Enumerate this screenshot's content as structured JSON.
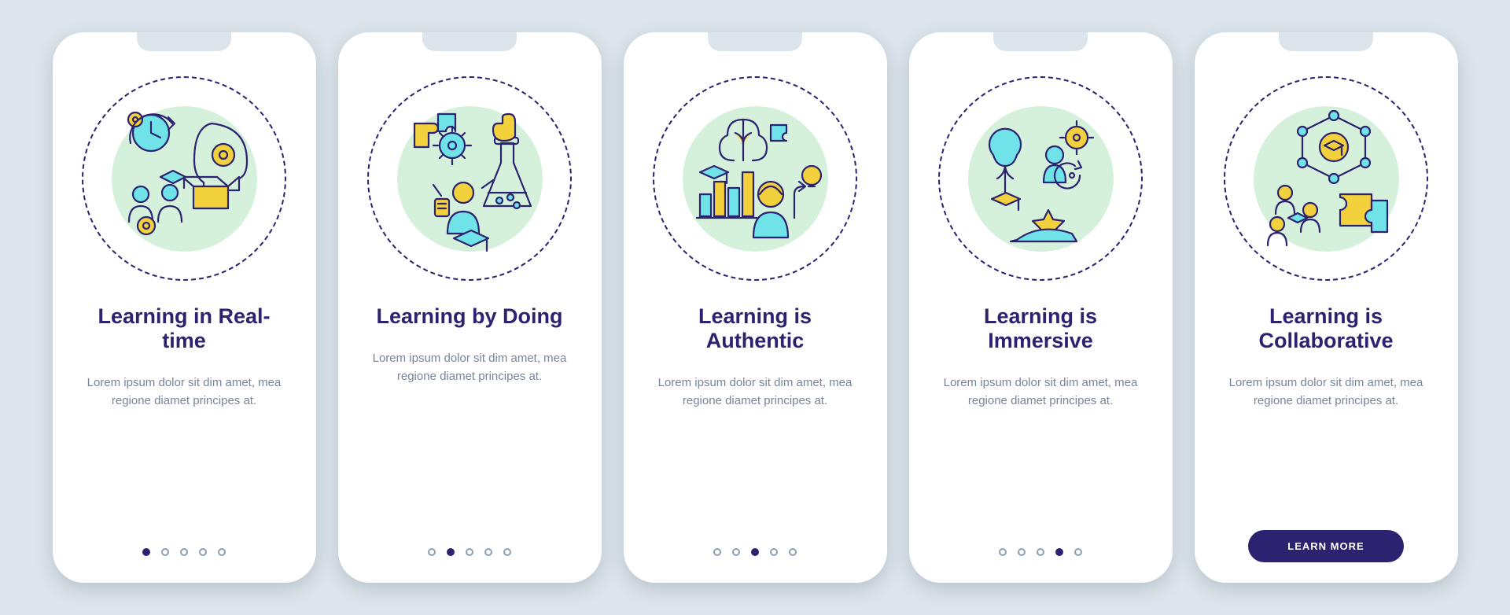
{
  "colors": {
    "accent": "#2b2370",
    "mint": "#d5f1dc",
    "yellow": "#f3d13c",
    "cyan": "#6fe3e8",
    "bg": "#dce5eb"
  },
  "cards": [
    {
      "icon_name": "realtime-learning-icon",
      "title": "Learning in Real-time",
      "desc": "Lorem ipsum dolor sit dim amet, mea regione diamet principes at.",
      "active_dot": 0,
      "has_cta": false
    },
    {
      "icon_name": "learning-by-doing-icon",
      "title": "Learning by Doing",
      "desc": "Lorem ipsum dolor sit dim amet, mea regione diamet principes at.",
      "active_dot": 1,
      "has_cta": false
    },
    {
      "icon_name": "authentic-learning-icon",
      "title": "Learning is Authentic",
      "desc": "Lorem ipsum dolor sit dim amet, mea regione diamet principes at.",
      "active_dot": 2,
      "has_cta": false
    },
    {
      "icon_name": "immersive-learning-icon",
      "title": "Learning is Immersive",
      "desc": "Lorem ipsum dolor sit dim amet, mea regione diamet principes at.",
      "active_dot": 3,
      "has_cta": false
    },
    {
      "icon_name": "collaborative-learning-icon",
      "title": "Learning is Collaborative",
      "desc": "Lorem ipsum dolor sit dim amet, mea regione diamet principes at.",
      "active_dot": 4,
      "has_cta": true,
      "cta_label": "LEARN MORE"
    }
  ],
  "dot_count": 5
}
